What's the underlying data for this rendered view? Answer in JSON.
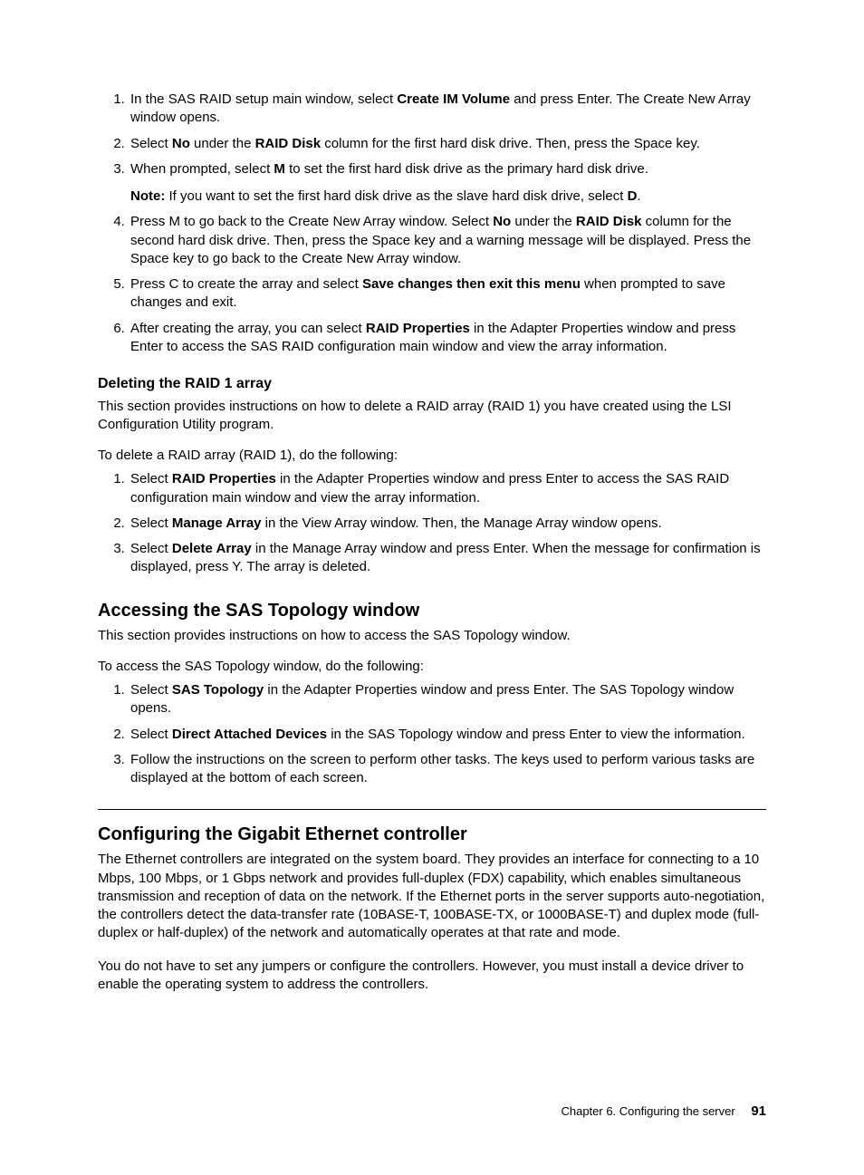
{
  "list1": {
    "i1a": "In the SAS RAID setup main window, select ",
    "i1b": "Create IM Volume",
    "i1c": " and press Enter. The Create New Array window opens.",
    "i2a": "Select ",
    "i2b": "No",
    "i2c": " under the ",
    "i2d": "RAID Disk",
    "i2e": " column for the first hard disk drive. Then, press the Space key.",
    "i3a": "When prompted, select ",
    "i3b": "M",
    "i3c": " to set the first hard disk drive as the primary hard disk drive.",
    "note_label": "Note:",
    "note_a": " If you want to set the first hard disk drive as the slave hard disk drive, select ",
    "note_b": "D",
    "note_c": ".",
    "i4a": "Press M to go back to the Create New Array window. Select ",
    "i4b": "No",
    "i4c": " under the ",
    "i4d": "RAID Disk",
    "i4e": " column for the second hard disk drive. Then, press the Space key and a warning message will be displayed. Press the Space key to go back to the Create New Array window.",
    "i5a": "Press C to create the array and select ",
    "i5b": "Save changes then exit this menu",
    "i5c": " when prompted to save changes and exit.",
    "i6a": "After creating the array, you can select ",
    "i6b": "RAID Properties",
    "i6c": " in the Adapter Properties window and press Enter to access the SAS RAID configuration main window and view the array information."
  },
  "h_del": "Deleting the RAID 1 array",
  "p_del": "This section provides instructions on how to delete a RAID array (RAID 1) you have created using the LSI Configuration Utility program.",
  "p_del2": "To delete a RAID array (RAID 1), do the following:",
  "list2": {
    "i1a": "Select ",
    "i1b": "RAID Properties",
    "i1c": " in the Adapter Properties window and press Enter to access the SAS RAID configuration main window and view the array information.",
    "i2a": "Select ",
    "i2b": "Manage Array",
    "i2c": " in the View Array window. Then, the Manage Array window opens.",
    "i3a": "Select ",
    "i3b": "Delete Array",
    "i3c": " in the Manage Array window and press Enter. When the message for confirmation is displayed, press Y. The array is deleted."
  },
  "h_sas": "Accessing the SAS Topology window",
  "p_sas": "This section provides instructions on how to access the SAS Topology window.",
  "p_sas2": "To access the SAS Topology window, do the following:",
  "list3": {
    "i1a": "Select ",
    "i1b": "SAS Topology",
    "i1c": " in the Adapter Properties window and press Enter. The SAS Topology window opens.",
    "i2a": "Select ",
    "i2b": "Direct Attached Devices",
    "i2c": " in the SAS Topology window and press Enter to view the information.",
    "i3": "Follow the instructions on the screen to perform other tasks. The keys used to perform various tasks are displayed at the bottom of each screen."
  },
  "h_eth": "Configuring the Gigabit Ethernet controller",
  "p_eth1": "The Ethernet controllers are integrated on the system board. They provides an interface for connecting to a 10 Mbps, 100 Mbps, or 1 Gbps network and provides full-duplex (FDX) capability, which enables simultaneous transmission and reception of data on the network. If the Ethernet ports in the server supports auto-negotiation, the controllers detect the data-transfer rate (10BASE-T, 100BASE-TX, or 1000BASE-T) and duplex mode (full-duplex or half-duplex) of the network and automatically operates at that rate and mode.",
  "p_eth2": "You do not have to set any jumpers or configure the controllers. However, you must install a device driver to enable the operating system to address the controllers.",
  "footer": {
    "chapter": "Chapter 6. Configuring the server",
    "page": "91"
  }
}
